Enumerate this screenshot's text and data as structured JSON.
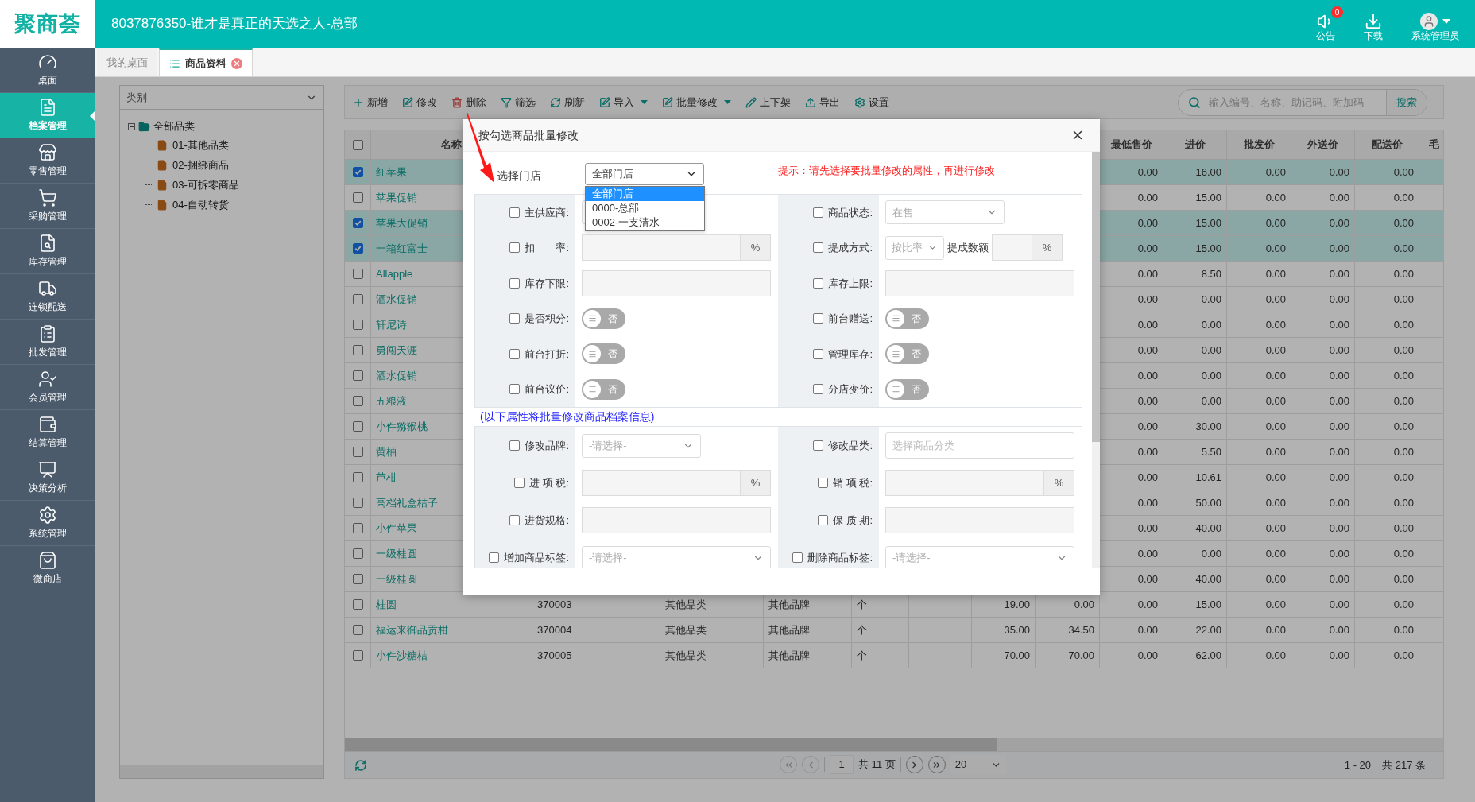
{
  "header": {
    "logo": "聚商荟",
    "title": "8037876350-谁才是真正的天选之人-总部",
    "actions": [
      {
        "kind": "notice",
        "label": "公告",
        "badge": "0"
      },
      {
        "kind": "download",
        "label": "下载"
      },
      {
        "kind": "user",
        "label": "系统管理员"
      }
    ]
  },
  "sidebar": {
    "items": [
      {
        "label": "桌面",
        "selected": false
      },
      {
        "label": "档案管理",
        "selected": true
      },
      {
        "label": "零售管理",
        "selected": false
      },
      {
        "label": "采购管理",
        "selected": false
      },
      {
        "label": "库存管理",
        "selected": false
      },
      {
        "label": "连锁配送",
        "selected": false
      },
      {
        "label": "批发管理",
        "selected": false
      },
      {
        "label": "会员管理",
        "selected": false
      },
      {
        "label": "结算管理",
        "selected": false
      },
      {
        "label": "决策分析",
        "selected": false
      },
      {
        "label": "系统管理",
        "selected": false
      },
      {
        "label": "微商店",
        "selected": false
      }
    ]
  },
  "tabs": [
    {
      "label": "我的桌面",
      "selected": false,
      "closable": false
    },
    {
      "label": "商品资料",
      "selected": true,
      "closable": true
    }
  ],
  "category_panel": {
    "filter": "类别",
    "tree": [
      {
        "label": "全部品类",
        "expanded": true,
        "children": [
          {
            "label": "01-其他品类"
          },
          {
            "label": "02-捆绑商品"
          },
          {
            "label": "03-可拆零商品"
          },
          {
            "label": "04-自动转货"
          }
        ]
      }
    ]
  },
  "toolbar": {
    "buttons": [
      {
        "label": "新增",
        "dropdown": false
      },
      {
        "label": "修改",
        "dropdown": false
      },
      {
        "label": "删除",
        "dropdown": false
      },
      {
        "label": "筛选",
        "dropdown": false
      },
      {
        "label": "刷新",
        "dropdown": false
      },
      {
        "label": "导入",
        "dropdown": true
      },
      {
        "label": "批量修改",
        "dropdown": true
      },
      {
        "label": "上下架",
        "dropdown": false
      },
      {
        "label": "导出",
        "dropdown": false
      },
      {
        "label": "设置",
        "dropdown": false
      }
    ],
    "search": {
      "placeholder": "输入编号、名称、助记码、附加码",
      "button": "搜索"
    }
  },
  "table": {
    "select_all": false,
    "name_column": "名称",
    "price_columns": [
      "最低售价",
      "进价",
      "批发价",
      "外送价",
      "配送价",
      "毛"
    ],
    "rows": [
      {
        "checked": true,
        "name": "红苹果",
        "prices": [
          "0.00",
          "16.00",
          "0.00",
          "0.00",
          "0.00"
        ]
      },
      {
        "checked": false,
        "name": "苹果促销",
        "prices": [
          "0.00",
          "15.00",
          "0.00",
          "0.00",
          "0.00"
        ]
      },
      {
        "checked": true,
        "name": "苹果大促销",
        "prices": [
          "0.00",
          "15.00",
          "0.00",
          "0.00",
          "0.00"
        ]
      },
      {
        "checked": true,
        "name": "一箱红富士",
        "prices": [
          "0.00",
          "15.00",
          "0.00",
          "0.00",
          "0.00"
        ]
      },
      {
        "checked": false,
        "name": "Allapple",
        "prices": [
          "0.00",
          "8.50",
          "0.00",
          "0.00",
          "0.00"
        ]
      },
      {
        "checked": false,
        "name": "酒水促销",
        "prices": [
          "0.00",
          "0.00",
          "0.00",
          "0.00",
          "0.00"
        ]
      },
      {
        "checked": false,
        "name": "轩尼诗",
        "prices": [
          "0.00",
          "0.00",
          "0.00",
          "0.00",
          "0.00"
        ]
      },
      {
        "checked": false,
        "name": "勇闯天涯",
        "prices": [
          "0.00",
          "0.00",
          "0.00",
          "0.00",
          "0.00"
        ]
      },
      {
        "checked": false,
        "name": "酒水促销",
        "prices": [
          "0.00",
          "0.00",
          "0.00",
          "0.00",
          "0.00"
        ]
      },
      {
        "checked": false,
        "name": "五粮液",
        "prices": [
          "0.00",
          "0.00",
          "0.00",
          "0.00",
          "0.00"
        ]
      },
      {
        "checked": false,
        "name": "小件猕猴桃",
        "prices": [
          "0.00",
          "30.00",
          "0.00",
          "0.00",
          "0.00"
        ]
      },
      {
        "checked": false,
        "name": "黄柚",
        "prices": [
          "0.00",
          "5.50",
          "0.00",
          "0.00",
          "0.00"
        ]
      },
      {
        "checked": false,
        "name": "芦柑",
        "prices": [
          "0.00",
          "10.61",
          "0.00",
          "0.00",
          "0.00"
        ]
      },
      {
        "checked": false,
        "name": "高档礼盒桔子",
        "prices": [
          "0.00",
          "50.00",
          "0.00",
          "0.00",
          "0.00"
        ]
      },
      {
        "checked": false,
        "name": "小件苹果",
        "prices": [
          "0.00",
          "40.00",
          "0.00",
          "0.00",
          "0.00"
        ]
      },
      {
        "checked": false,
        "name": "一级桂圆",
        "prices": [
          "0.00",
          "0.00",
          "0.00",
          "0.00",
          "0.00"
        ]
      },
      {
        "checked": false,
        "name": "一级桂圆",
        "prices": [
          "0.00",
          "40.00",
          "0.00",
          "0.00",
          "0.00"
        ]
      },
      {
        "checked": false,
        "name": "桂圆",
        "column_2": "370003",
        "column_3": "其他品类",
        "column_4": "其他品牌",
        "column_5": "个",
        "column_7": "19.00",
        "column_8": "0.00",
        "prices": [
          "0.00",
          "15.00",
          "0.00",
          "0.00",
          "0.00"
        ]
      },
      {
        "checked": false,
        "name": "福运来御品贡柑",
        "column_2": "370004",
        "column_3": "其他品类",
        "column_4": "其他品牌",
        "column_5": "个",
        "column_7": "35.00",
        "column_8": "34.50",
        "prices": [
          "0.00",
          "22.00",
          "0.00",
          "0.00",
          "0.00"
        ]
      },
      {
        "checked": false,
        "name": "小件沙糖桔",
        "column_2": "370005",
        "column_3": "其他品类",
        "column_4": "其他品牌",
        "column_5": "个",
        "column_7": "70.00",
        "column_8": "70.00",
        "prices": [
          "0.00",
          "62.00",
          "0.00",
          "0.00",
          "0.00"
        ]
      }
    ]
  },
  "pager": {
    "page": "1",
    "total_pages": "共 11 页",
    "page_size": "20",
    "range": "1 - 20",
    "total": "共 217 条"
  },
  "dialog": {
    "title": "按勾选商品批量修改",
    "store_label": "选择门店",
    "store_value": "全部门店",
    "store_options": [
      {
        "label": "全部门店",
        "selected": true
      },
      {
        "label": "0000-总部",
        "selected": false
      },
      {
        "label": "0002-一支清水",
        "selected": false
      }
    ],
    "hint": "提示：请先选择要批量修改的属性，再进行修改",
    "section_1": [
      {
        "label": "主供应商:",
        "checked": false,
        "kind": "select"
      },
      {
        "label": "商品状态:",
        "checked": false,
        "kind": "select",
        "value": "在售"
      },
      {
        "label": "扣　　率:",
        "checked": false,
        "kind": "percent",
        "unit": "%"
      },
      {
        "label": "提成方式:",
        "checked": false,
        "kind": "commission",
        "value": "按比率",
        "extra_label": "提成数额",
        "unit": "%"
      },
      {
        "label": "库存下限:",
        "checked": false,
        "kind": "input"
      },
      {
        "label": "库存上限:",
        "checked": false,
        "kind": "input"
      },
      {
        "label": "是否积分:",
        "checked": false,
        "kind": "toggle",
        "on": false,
        "text": "否"
      },
      {
        "label": "前台赠送:",
        "checked": false,
        "kind": "toggle",
        "on": false,
        "text": "否"
      },
      {
        "label": "前台打折:",
        "checked": false,
        "kind": "toggle",
        "on": false,
        "text": "否"
      },
      {
        "label": "管理库存:",
        "checked": false,
        "kind": "toggle",
        "on": false,
        "text": "否"
      },
      {
        "label": "前台议价:",
        "checked": false,
        "kind": "toggle",
        "on": false,
        "text": "否"
      },
      {
        "label": "分店变价:",
        "checked": false,
        "kind": "toggle",
        "on": false,
        "text": "否"
      }
    ],
    "note": "(以下属性将批量修改商品档案信息)",
    "section_2": [
      {
        "label": "修改品牌:",
        "checked": false,
        "kind": "select",
        "value": "-请选择-"
      },
      {
        "label": "修改品类:",
        "checked": false,
        "kind": "text_input",
        "placeholder": "选择商品分类"
      },
      {
        "label": "进 项 税:",
        "checked": false,
        "kind": "percent",
        "unit": "%"
      },
      {
        "label": "销 项 税:",
        "checked": false,
        "kind": "percent",
        "unit": "%"
      },
      {
        "label": "进货规格:",
        "checked": false,
        "kind": "input"
      },
      {
        "label": "保 质 期:",
        "checked": false,
        "kind": "input"
      },
      {
        "label": "增加商品标签:",
        "checked": false,
        "kind": "long_select",
        "value": "-请选择-"
      },
      {
        "label": "删除商品标签:",
        "checked": false,
        "kind": "long_select",
        "value": "-请选择-"
      }
    ]
  }
}
